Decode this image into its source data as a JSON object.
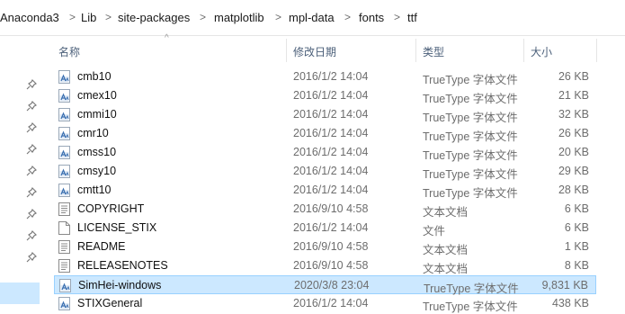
{
  "breadcrumb": {
    "items": [
      "Anaconda3",
      "Lib",
      "site-packages",
      "matplotlib",
      "mpl-data",
      "fonts",
      "ttf"
    ],
    "separator": ">"
  },
  "columns": {
    "name": "名称",
    "date": "修改日期",
    "type": "类型",
    "size": "大小"
  },
  "files": [
    {
      "name": "cmb10",
      "date": "2016/1/2 14:04",
      "type": "TrueType 字体文件",
      "size": "26 KB",
      "icon": "font-file-icon"
    },
    {
      "name": "cmex10",
      "date": "2016/1/2 14:04",
      "type": "TrueType 字体文件",
      "size": "21 KB",
      "icon": "font-file-icon"
    },
    {
      "name": "cmmi10",
      "date": "2016/1/2 14:04",
      "type": "TrueType 字体文件",
      "size": "32 KB",
      "icon": "font-file-icon"
    },
    {
      "name": "cmr10",
      "date": "2016/1/2 14:04",
      "type": "TrueType 字体文件",
      "size": "26 KB",
      "icon": "font-file-icon"
    },
    {
      "name": "cmss10",
      "date": "2016/1/2 14:04",
      "type": "TrueType 字体文件",
      "size": "20 KB",
      "icon": "font-file-icon"
    },
    {
      "name": "cmsy10",
      "date": "2016/1/2 14:04",
      "type": "TrueType 字体文件",
      "size": "29 KB",
      "icon": "font-file-icon"
    },
    {
      "name": "cmtt10",
      "date": "2016/1/2 14:04",
      "type": "TrueType 字体文件",
      "size": "28 KB",
      "icon": "font-file-icon"
    },
    {
      "name": "COPYRIGHT",
      "date": "2016/9/10 4:58",
      "type": "文本文档",
      "size": "6 KB",
      "icon": "text-document-icon"
    },
    {
      "name": "LICENSE_STIX",
      "date": "2016/1/2 14:04",
      "type": "文件",
      "size": "6 KB",
      "icon": "blank-file-icon"
    },
    {
      "name": "README",
      "date": "2016/9/10 4:58",
      "type": "文本文档",
      "size": "1 KB",
      "icon": "text-document-icon"
    },
    {
      "name": "RELEASENOTES",
      "date": "2016/9/10 4:58",
      "type": "文本文档",
      "size": "8 KB",
      "icon": "text-document-icon"
    },
    {
      "name": "SimHei-windows",
      "date": "2020/3/8 23:04",
      "type": "TrueType 字体文件",
      "size": "9,831 KB",
      "icon": "font-file-icon",
      "selected": true
    },
    {
      "name": "STIXGeneral",
      "date": "2016/1/2 14:04",
      "type": "TrueType 字体文件",
      "size": "438 KB",
      "icon": "font-file-icon"
    }
  ],
  "colors": {
    "selection_bg": "#cce8ff",
    "selection_border": "#99d1ff",
    "header_text": "#4c607a",
    "secondary_text": "#6d6d6d"
  }
}
